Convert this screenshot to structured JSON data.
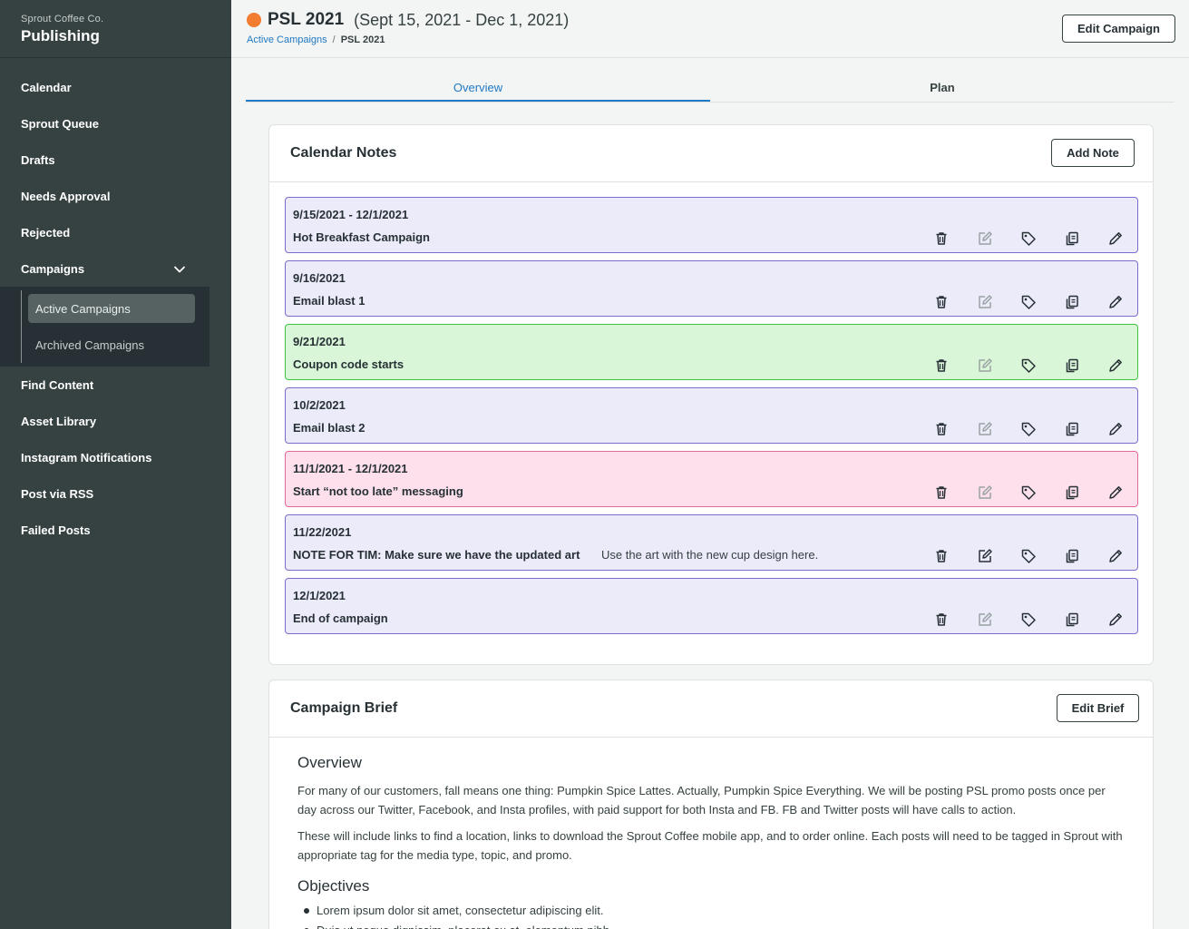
{
  "sidebar": {
    "org": "Sprout Coffee Co.",
    "app": "Publishing",
    "items": [
      {
        "label": "Calendar"
      },
      {
        "label": "Sprout Queue"
      },
      {
        "label": "Drafts"
      },
      {
        "label": "Needs Approval"
      },
      {
        "label": "Rejected"
      },
      {
        "label": "Campaigns"
      }
    ],
    "campaign_sub": [
      {
        "label": "Active Campaigns",
        "active": true
      },
      {
        "label": "Archived Campaigns",
        "active": false
      }
    ],
    "items_after": [
      {
        "label": "Find Content"
      },
      {
        "label": "Asset Library"
      },
      {
        "label": "Instagram Notifications"
      },
      {
        "label": "Post via RSS"
      },
      {
        "label": "Failed Posts"
      }
    ]
  },
  "header": {
    "title": "PSL 2021",
    "subtitle": "(Sept 15, 2021 - Dec 1, 2021)",
    "status_color": "#f27d31",
    "breadcrumb": {
      "parent": "Active Campaigns",
      "separator": "/",
      "current": "PSL 2021"
    },
    "edit_campaign_label": "Edit Campaign"
  },
  "tabs": [
    {
      "label": "Overview",
      "active": true
    },
    {
      "label": "Plan",
      "active": false
    }
  ],
  "calendar_notes": {
    "title": "Calendar Notes",
    "add_note_label": "Add Note",
    "notes": [
      {
        "date": "9/15/2021 - 12/1/2021",
        "text": "Hot Breakfast Campaign",
        "desc": "",
        "color": "purple"
      },
      {
        "date": "9/16/2021",
        "text": "Email blast 1",
        "desc": "",
        "color": "purple"
      },
      {
        "date": "9/21/2021",
        "text": "Coupon code starts",
        "desc": "",
        "color": "green"
      },
      {
        "date": "10/2/2021",
        "text": "Email blast 2",
        "desc": "",
        "color": "purple"
      },
      {
        "date": "11/1/2021 - 12/1/2021",
        "text": "Start “not too late” messaging",
        "desc": "",
        "color": "pink"
      },
      {
        "date": "11/22/2021",
        "text": "NOTE FOR TIM: Make sure we have the updated art",
        "desc": "Use the art with the new cup design here.",
        "color": "purple"
      },
      {
        "date": "12/1/2021",
        "text": "End of campaign",
        "desc": "",
        "color": "purple"
      }
    ]
  },
  "campaign_brief": {
    "title": "Campaign Brief",
    "edit_brief_label": "Edit Brief",
    "overview_heading": "Overview",
    "paragraphs": [
      "For many of our customers, fall means one thing: Pumpkin Spice Lattes. Actually, Pumpkin Spice Everything. We will be posting PSL promo posts once per day across our Twitter, Facebook, and Insta profiles, with paid support for both Insta and FB. FB and Twitter posts will have calls to action.",
      "These will include links to find a location, links to download the Sprout Coffee mobile app, and to order online. Each posts will need to be tagged in Sprout with appropriate tag for the media type, topic, and promo."
    ],
    "objectives_heading": "Objectives",
    "objectives": [
      "Lorem ipsum dolor sit amet, consectetur adipiscing elit.",
      "Duis ut neque dignissim, placerat ex at, elementum nibh."
    ]
  },
  "icons": {
    "delete": "trash-icon",
    "compose": "compose-icon",
    "tag": "tag-icon",
    "copy": "copy-icon",
    "edit": "pencil-icon"
  }
}
